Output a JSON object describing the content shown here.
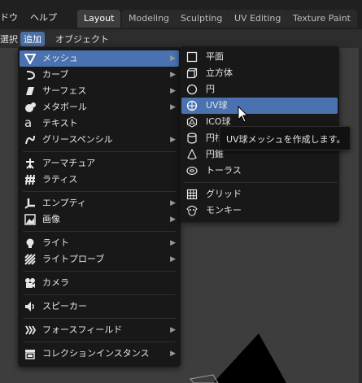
{
  "topbar": {
    "menus": [
      "ドウ",
      "ヘルプ"
    ],
    "workspace_tabs": [
      "Layout",
      "Modeling",
      "Sculpting",
      "UV Editing",
      "Texture Paint"
    ],
    "active_tab": "Layout"
  },
  "header": {
    "items": [
      "選択",
      "追加",
      "オブジェクト"
    ],
    "active": "追加"
  },
  "add_menu": {
    "items": [
      {
        "label": "メッシュ",
        "icon": "mesh-icon",
        "submenu": true,
        "highlighted": true
      },
      {
        "label": "カーブ",
        "icon": "curve-icon",
        "submenu": true
      },
      {
        "label": "サーフェス",
        "icon": "surface-icon",
        "submenu": true
      },
      {
        "label": "メタボール",
        "icon": "metaball-icon",
        "submenu": true
      },
      {
        "label": "テキスト",
        "icon": "text-icon",
        "submenu": false
      },
      {
        "label": "グリースペンシル",
        "icon": "grease-pencil-icon",
        "submenu": true
      },
      {
        "label": "アーマチュア",
        "icon": "armature-icon",
        "submenu": false
      },
      {
        "label": "ラティス",
        "icon": "lattice-icon",
        "submenu": false
      },
      {
        "label": "エンプティ",
        "icon": "empty-icon",
        "submenu": true
      },
      {
        "label": "画像",
        "icon": "image-icon",
        "submenu": true
      },
      {
        "label": "ライト",
        "icon": "light-icon",
        "submenu": true
      },
      {
        "label": "ライトプローブ",
        "icon": "light-probe-icon",
        "submenu": true
      },
      {
        "label": "カメラ",
        "icon": "camera-icon",
        "submenu": false
      },
      {
        "label": "スピーカー",
        "icon": "speaker-icon",
        "submenu": false
      },
      {
        "label": "フォースフィールド",
        "icon": "force-field-icon",
        "submenu": true
      },
      {
        "label": "コレクションインスタンス",
        "icon": "collection-instance-icon",
        "submenu": true
      }
    ]
  },
  "mesh_menu": {
    "items": [
      {
        "label": "平面",
        "icon": "plane-icon"
      },
      {
        "label": "立方体",
        "icon": "cube-icon"
      },
      {
        "label": "円",
        "icon": "circle-icon"
      },
      {
        "label": "UV球",
        "icon": "uv-sphere-icon",
        "highlighted": true
      },
      {
        "label": "ICO球",
        "icon": "ico-sphere-icon"
      },
      {
        "label": "円柱",
        "icon": "cylinder-icon"
      },
      {
        "label": "円錐",
        "icon": "cone-icon"
      },
      {
        "label": "トーラス",
        "icon": "torus-icon"
      },
      {
        "label": "グリッド",
        "icon": "grid-icon"
      },
      {
        "label": "モンキー",
        "icon": "monkey-icon"
      }
    ]
  },
  "tooltip": {
    "text": "UV球メッシュを作成します。"
  },
  "colors": {
    "highlight": "#4a72b0",
    "menu_bg": "#181818",
    "viewport_bg": "#3d3d3d"
  }
}
